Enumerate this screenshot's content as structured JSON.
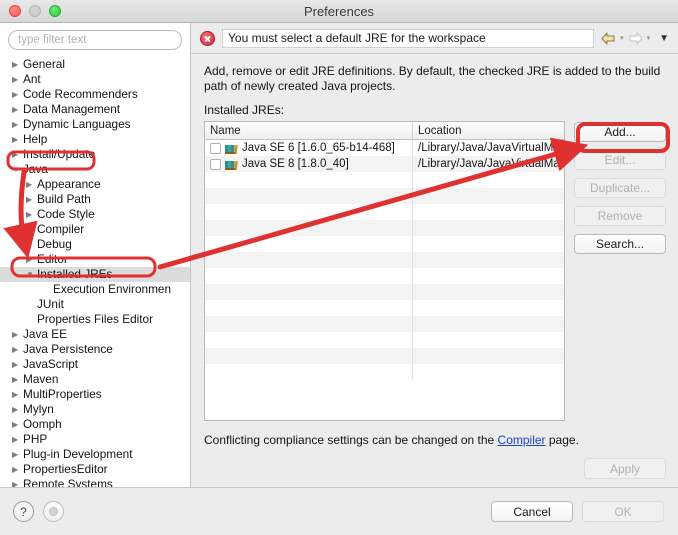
{
  "window": {
    "title": "Preferences",
    "traffic_lights": [
      "close-red",
      "minimize-gray",
      "zoom-green"
    ]
  },
  "sidebar": {
    "filter": {
      "placeholder": "type filter text",
      "value": ""
    },
    "items": [
      {
        "label": "General",
        "twisty": "▶",
        "indent": 0,
        "selected": false
      },
      {
        "label": "Ant",
        "twisty": "▶",
        "indent": 0,
        "selected": false
      },
      {
        "label": "Code Recommenders",
        "twisty": "▶",
        "indent": 0,
        "selected": false
      },
      {
        "label": "Data Management",
        "twisty": "▶",
        "indent": 0,
        "selected": false
      },
      {
        "label": "Dynamic Languages",
        "twisty": "▶",
        "indent": 0,
        "selected": false
      },
      {
        "label": "Help",
        "twisty": "▶",
        "indent": 0,
        "selected": false
      },
      {
        "label": "Install/Update",
        "twisty": "▶",
        "indent": 0,
        "selected": false
      },
      {
        "label": "Java",
        "twisty": "▼",
        "indent": 0,
        "selected": false
      },
      {
        "label": "Appearance",
        "twisty": "▶",
        "indent": 1,
        "selected": false
      },
      {
        "label": "Build Path",
        "twisty": "▶",
        "indent": 1,
        "selected": false
      },
      {
        "label": "Code Style",
        "twisty": "▶",
        "indent": 1,
        "selected": false
      },
      {
        "label": "Compiler",
        "twisty": "▶",
        "indent": 1,
        "selected": false
      },
      {
        "label": "Debug",
        "twisty": "▶",
        "indent": 1,
        "selected": false
      },
      {
        "label": "Editor",
        "twisty": "▶",
        "indent": 1,
        "selected": false
      },
      {
        "label": "Installed JREs",
        "twisty": "▼",
        "indent": 1,
        "selected": true
      },
      {
        "label": "Execution Environmen",
        "twisty": "",
        "indent": 2,
        "selected": false
      },
      {
        "label": "JUnit",
        "twisty": "",
        "indent": 1,
        "selected": false
      },
      {
        "label": "Properties Files Editor",
        "twisty": "",
        "indent": 1,
        "selected": false
      },
      {
        "label": "Java EE",
        "twisty": "▶",
        "indent": 0,
        "selected": false
      },
      {
        "label": "Java Persistence",
        "twisty": "▶",
        "indent": 0,
        "selected": false
      },
      {
        "label": "JavaScript",
        "twisty": "▶",
        "indent": 0,
        "selected": false
      },
      {
        "label": "Maven",
        "twisty": "▶",
        "indent": 0,
        "selected": false
      },
      {
        "label": "MultiProperties",
        "twisty": "▶",
        "indent": 0,
        "selected": false
      },
      {
        "label": "Mylyn",
        "twisty": "▶",
        "indent": 0,
        "selected": false
      },
      {
        "label": "Oomph",
        "twisty": "▶",
        "indent": 0,
        "selected": false
      },
      {
        "label": "PHP",
        "twisty": "▶",
        "indent": 0,
        "selected": false
      },
      {
        "label": "Plug-in Development",
        "twisty": "▶",
        "indent": 0,
        "selected": false
      },
      {
        "label": "PropertiesEditor",
        "twisty": "▶",
        "indent": 0,
        "selected": false
      },
      {
        "label": "Remote Systems",
        "twisty": "▶",
        "indent": 0,
        "selected": false
      }
    ]
  },
  "message_bar": {
    "icon": "error-icon",
    "text": "You must select a default JRE for the workspace",
    "nav": {
      "back_icon": "back-arrow-icon",
      "forward_icon": "forward-arrow-icon",
      "caret": "▾",
      "menu_caret": "▼"
    }
  },
  "panel": {
    "description": "Add, remove or edit JRE definitions. By default, the checked JRE is added to the build path of newly created Java projects.",
    "list_label": "Installed JREs:",
    "table": {
      "columns": [
        "Name",
        "Location"
      ],
      "rows": [
        {
          "checked": false,
          "icon": "jre-icon",
          "name": "Java SE 6 [1.6.0_65-b14-468]",
          "location": "/Library/Java/JavaVirtualMach"
        },
        {
          "checked": false,
          "icon": "jre-icon",
          "name": "Java SE 8 [1.8.0_40]",
          "location": "/Library/Java/JavaVirtualMach"
        }
      ]
    },
    "buttons": [
      {
        "label": "Add...",
        "enabled": true,
        "highlighted": true
      },
      {
        "label": "Edit...",
        "enabled": false,
        "highlighted": false
      },
      {
        "label": "Duplicate...",
        "enabled": false,
        "highlighted": false
      },
      {
        "label": "Remove",
        "enabled": false,
        "highlighted": false
      },
      {
        "label": "Search...",
        "enabled": true,
        "highlighted": false
      }
    ],
    "conflict_prefix": "Conflicting compliance settings can be changed on the ",
    "conflict_link": "Compiler",
    "conflict_suffix": " page.",
    "apply_label": "Apply",
    "apply_enabled": false
  },
  "bottom_bar": {
    "help_icon": "?",
    "secondary_icon": "preferences-dot-icon",
    "cancel_label": "Cancel",
    "ok_label": "OK",
    "ok_enabled": false
  },
  "annotations": {
    "color": "#e03131",
    "highlight_java": "Java",
    "highlight_installed_jres": "Installed JREs",
    "highlight_add_button": "Add..."
  }
}
